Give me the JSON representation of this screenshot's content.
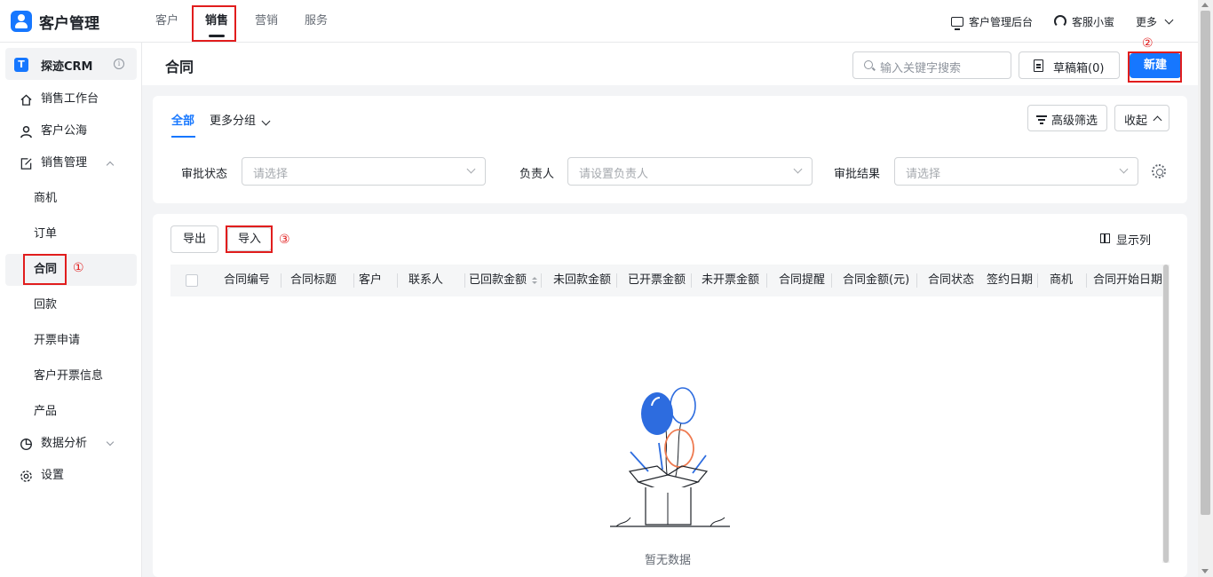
{
  "app": {
    "title": "客户管理"
  },
  "top_nav": {
    "items": [
      "客户",
      "销售",
      "营销",
      "服务"
    ],
    "active_index": 1
  },
  "top_right": {
    "admin": "客户管理后台",
    "service": "客服小蜜",
    "more": "更多"
  },
  "sidebar": {
    "crm_logo": "T",
    "crm_name": "探迹CRM",
    "info_glyph": "i",
    "items": [
      {
        "label": "销售工作台",
        "icon": "home-icon"
      },
      {
        "label": "客户公海",
        "icon": "user-icon"
      },
      {
        "label": "销售管理",
        "icon": "edit-icon",
        "expanded": true
      },
      {
        "label": "商机"
      },
      {
        "label": "订单"
      },
      {
        "label": "合同",
        "active": true
      },
      {
        "label": "回款"
      },
      {
        "label": "开票申请"
      },
      {
        "label": "客户开票信息"
      },
      {
        "label": "产品"
      },
      {
        "label": "数据分析",
        "icon": "pie-chart-icon",
        "expanded": false
      },
      {
        "label": "设置",
        "icon": "gear-icon"
      }
    ]
  },
  "annotations": {
    "step1": "①",
    "step2": "②",
    "step3": "③"
  },
  "header": {
    "title": "合同",
    "search_placeholder": "输入关键字搜索",
    "draft_label": "草稿箱(0)",
    "new_label": "新建"
  },
  "filters": {
    "tab_all": "全部",
    "tab_more": "更多分组",
    "advanced": "高级筛选",
    "collapse": "收起",
    "fields": [
      {
        "label": "审批状态",
        "placeholder": "请选择"
      },
      {
        "label": "负责人",
        "placeholder": "请设置负责人"
      },
      {
        "label": "审批结果",
        "placeholder": "请选择"
      }
    ]
  },
  "table": {
    "export_label": "导出",
    "import_label": "导入",
    "columns_label": "显示列",
    "columns": [
      "合同编号",
      "合同标题",
      "客户",
      "联系人",
      "已回款金额",
      "未回款金额",
      "已开票金额",
      "未开票金额",
      "合同提醒",
      "合同金额(元)",
      "合同状态",
      "签约日期",
      "商机",
      "合同开始日期"
    ],
    "sorted_column": "已回款金额",
    "empty_text": "暂无数据"
  },
  "colors": {
    "accent": "#1677ff",
    "annotation": "#e11d1d",
    "balloon_blue": "#2d6cdf",
    "balloon_orange": "#ee7a50"
  }
}
